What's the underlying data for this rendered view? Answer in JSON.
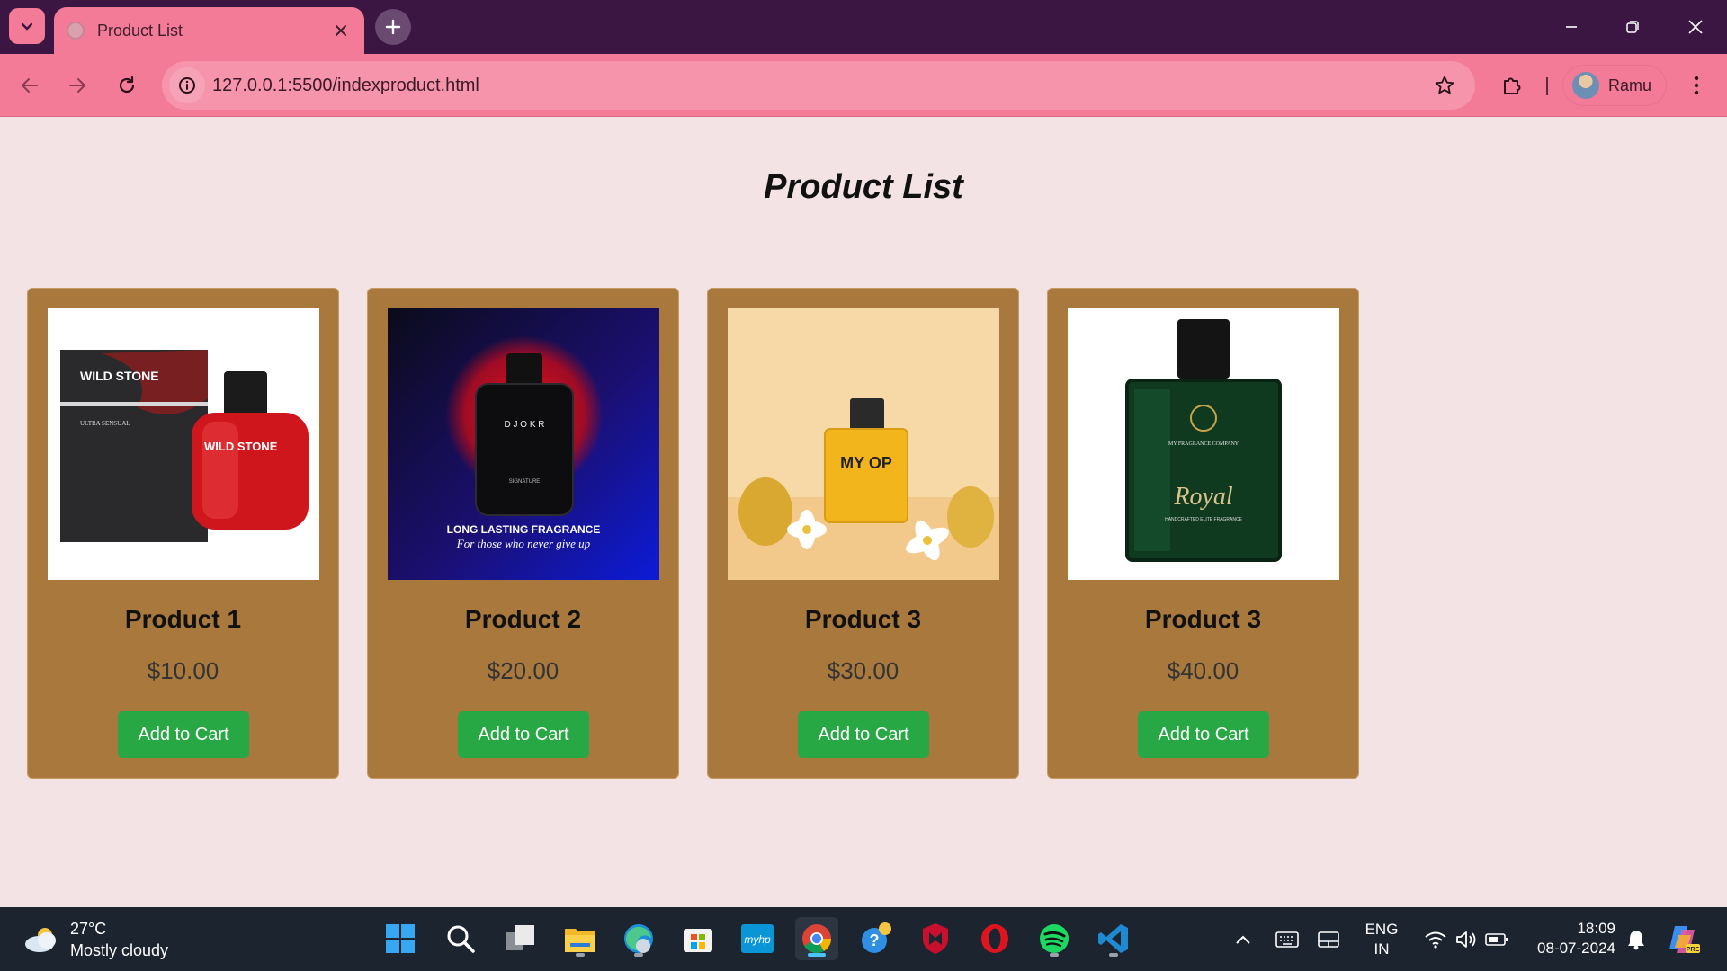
{
  "browser": {
    "tab_title": "Product List",
    "url": "127.0.0.1:5500/indexproduct.html",
    "profile_name": "Ramu"
  },
  "page": {
    "title": "Product List",
    "products": [
      {
        "name": "Product 1",
        "price": "$10.00",
        "button_label": "Add to Cart",
        "image": "wild-stone-perfume-image",
        "image_text": {
          "brand": "WILD STONE",
          "sub": "ULTRA SENSUAL"
        }
      },
      {
        "name": "Product 2",
        "price": "$20.00",
        "button_label": "Add to Cart",
        "image": "djokr-perfume-image",
        "image_text": {
          "brand": "D J O K R",
          "sub": "SIGNATURE",
          "headline": "LONG LASTING FRAGRANCE",
          "tagline": "For those who never give up"
        }
      },
      {
        "name": "Product 3",
        "price": "$30.00",
        "button_label": "Add to Cart",
        "image": "myop-perfume-image",
        "image_text": {
          "brand": "MY OP"
        }
      },
      {
        "name": "Product 3",
        "price": "$40.00",
        "button_label": "Add to Cart",
        "image": "royal-perfume-image",
        "image_text": {
          "brand": "MY FRAGRANCE COMPANY",
          "name": "Royal",
          "sub": "HANDCRAFTED ELITE FRAGRANCE"
        }
      }
    ]
  },
  "colors": {
    "tabbar_bg": "#3b1643",
    "toolbar_bg": "#f37b98",
    "page_bg": "#f3e3e5",
    "card_bg": "#a8783d",
    "button_bg": "#28a745"
  },
  "taskbar": {
    "weather_temp": "27°C",
    "weather_desc": "Mostly cloudy",
    "language": "ENG",
    "region": "IN",
    "time": "18:09",
    "date": "08-07-2024",
    "apps": [
      "start-icon",
      "search-icon",
      "task-view-icon",
      "file-explorer-icon",
      "edge-icon",
      "microsoft-store-icon",
      "myhp-icon",
      "chrome-icon",
      "help-icon",
      "mcafee-icon",
      "opera-icon",
      "spotify-icon",
      "vscode-icon"
    ]
  }
}
